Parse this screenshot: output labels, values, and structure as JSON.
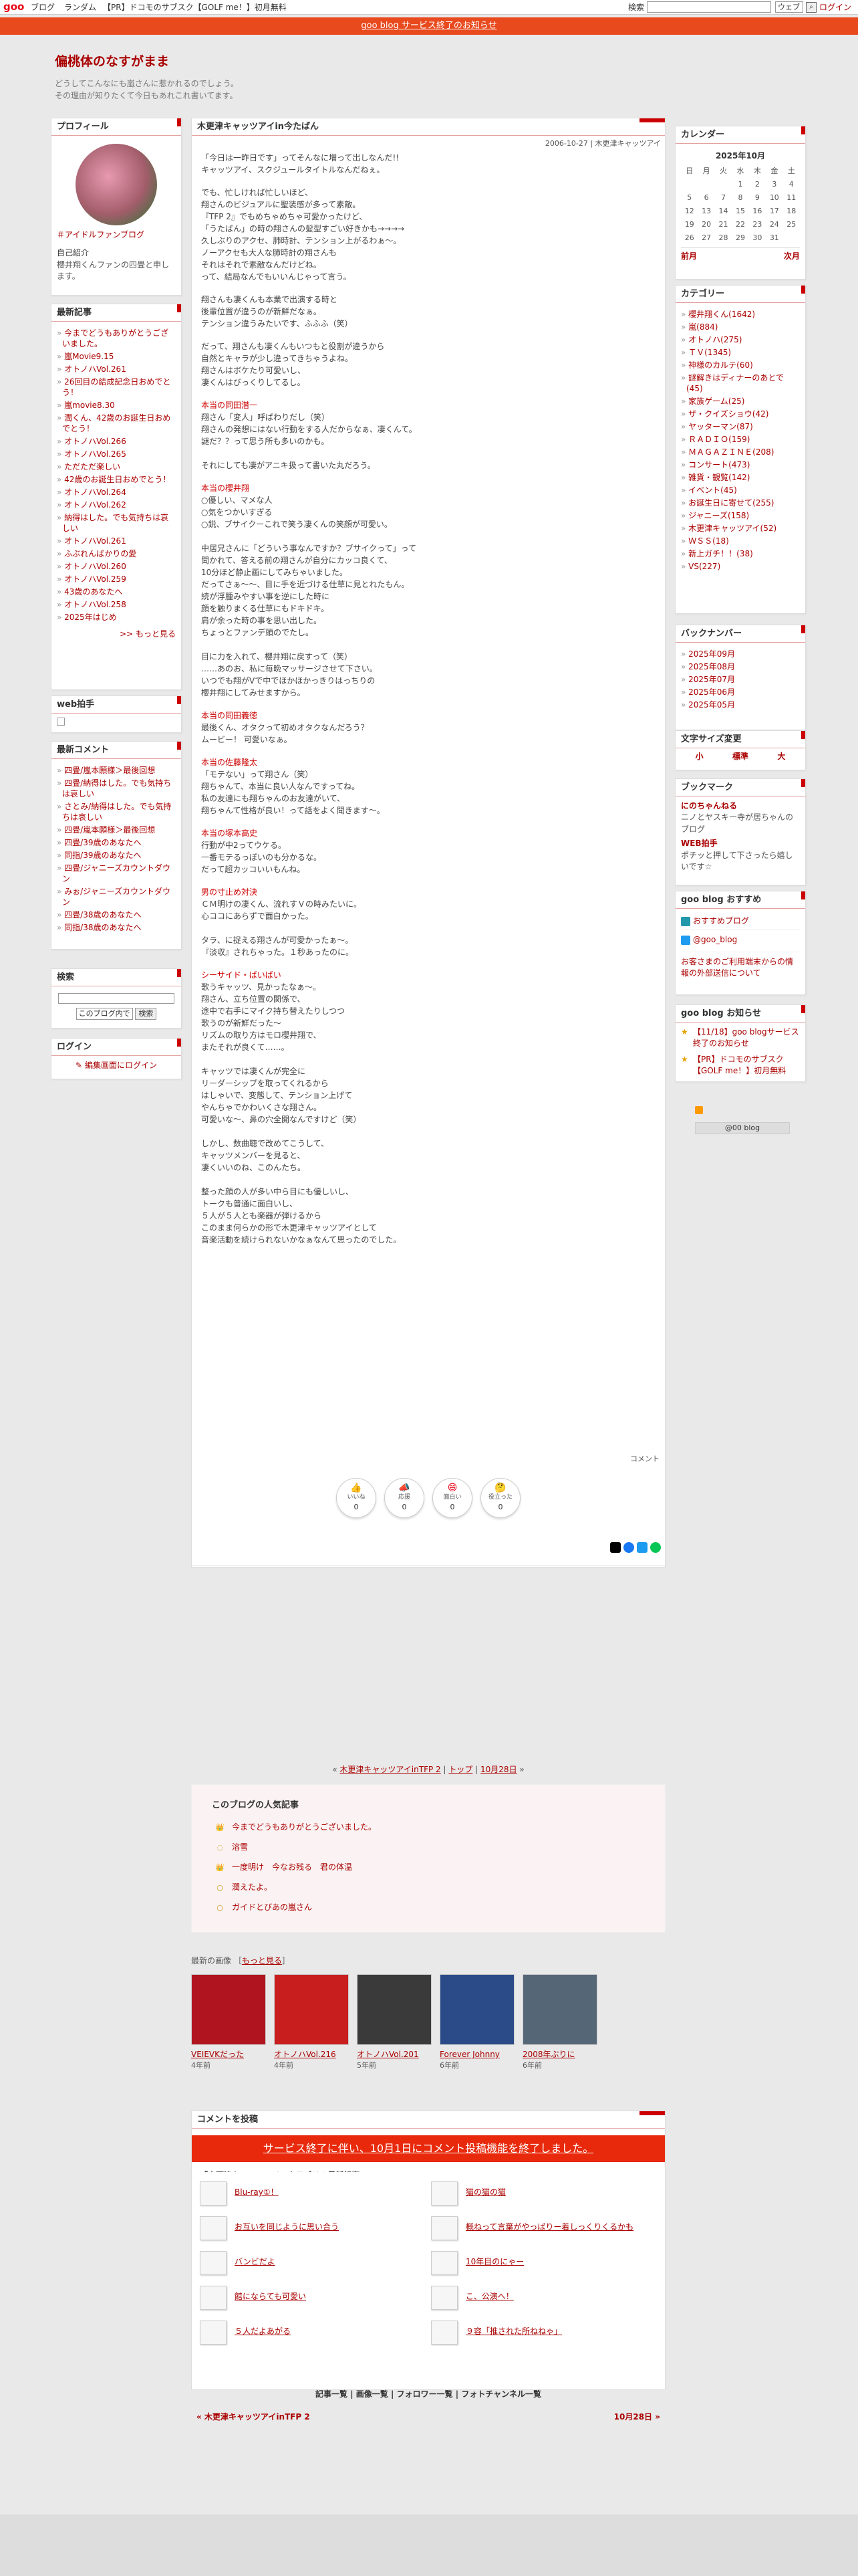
{
  "topbar": {
    "logo": "goo",
    "links": [
      "ブログ",
      "ランダム",
      "【PR】ドコモのサブスク【GOLF me！】初月無料"
    ],
    "search_label": "検索",
    "search_scope": "ウェブ",
    "login": "ログイン"
  },
  "notice": "goo blog サービス終了のお知らせ",
  "blog": {
    "title": "偏桃体のなすがまま",
    "desc1": "どうしてこんなにも嵐さんに惹かれるのでしょう。",
    "desc2": "その理由が知りたくて今日もあれこれ書いてます。"
  },
  "profile": {
    "title": "プロフィール",
    "name": "＃アイドルファンブログ",
    "intro_label": "自己紹介",
    "intro": "櫻井翔くんファンの四畳と申します。"
  },
  "recent": {
    "title": "最新記事",
    "items": [
      "今までどうもありがとうございました。",
      "嵐Movie9.15",
      "オトノハVol.261",
      "26回目の結成記念日おめでとう！",
      "嵐movie8.30",
      "潤くん、42歳のお誕生日おめでとう！",
      "オトノハVol.266",
      "オトノハVol.265",
      "ただただ楽しい",
      "42歳のお誕生日おめでとう！",
      "オトノハVol.264",
      "オトノハVol.262",
      "納得はした。でも気持ちは哀しい",
      "オトノハVol.261",
      "ふぶれんばかりの愛",
      "オトノハVol.260",
      "オトノハVol.259",
      "43歳のあなたへ",
      "オトノハVol.258",
      "2025年はじめ"
    ],
    "more": ">> もっと見る"
  },
  "webclap": {
    "title": "web拍手"
  },
  "comments": {
    "title": "最新コメント",
    "items": [
      "四畳/嵐本願様＞最後回想",
      "四畳/納得はした。でも気持ちは哀しい",
      "さとみ/納得はした。でも気持ちは哀しい",
      "四畳/嵐本願様＞最後回想",
      "四畳/39歳のあなたへ",
      "同指/39歳のあなたへ",
      "四畳/ジャニーズカウントダウン",
      "みぉ/ジャニーズカウントダウン",
      "四畳/38歳のあなたへ",
      "同指/38歳のあなたへ"
    ]
  },
  "search": {
    "title": "検索",
    "scope": "このブログ内で",
    "button": "検索"
  },
  "login": {
    "title": "ログイン",
    "link": "編集画面にログイン"
  },
  "calendar": {
    "title": "カレンダー",
    "month": "2025年10月",
    "days": [
      "日",
      "月",
      "火",
      "水",
      "木",
      "金",
      "土"
    ],
    "weeks": [
      [
        "",
        "",
        "",
        "1",
        "2",
        "3",
        "4"
      ],
      [
        "5",
        "6",
        "7",
        "8",
        "9",
        "10",
        "11"
      ],
      [
        "12",
        "13",
        "14",
        "15",
        "16",
        "17",
        "18"
      ],
      [
        "19",
        "20",
        "21",
        "22",
        "23",
        "24",
        "25"
      ],
      [
        "26",
        "27",
        "28",
        "29",
        "30",
        "31",
        ""
      ]
    ],
    "prev": "前月",
    "next": "次月"
  },
  "categories": {
    "title": "カテゴリー",
    "items": [
      "櫻井翔くん(1642)",
      "嵐(884)",
      "オトノハ(275)",
      "ＴＶ(1345)",
      "神様のカルテ(60)",
      "謎解きはディナーのあとで(45)",
      "家族ゲーム(25)",
      "ザ・クイズショウ(42)",
      "ヤッターマン(87)",
      "ＲＡＤＩＯ(159)",
      "ＭＡＧＡＺＩＮＥ(208)",
      "コンサート(473)",
      "雑貨・観覧(142)",
      "イベント(45)",
      "お誕生日に寄せて(255)",
      "ジャニーズ(158)",
      "木更津キャッツアイ(52)",
      "ＷＳＳ(18)",
      "新上ガチ！！(38)",
      "VS(227)"
    ]
  },
  "backnumber": {
    "title": "バックナンバー",
    "items": [
      "2025年09月",
      "2025年08月",
      "2025年07月",
      "2025年06月",
      "2025年05月"
    ]
  },
  "fontsize": {
    "title": "文字サイズ変更",
    "small": "小",
    "normal": "標準",
    "large": "大"
  },
  "bookmark": {
    "title": "ブックマーク",
    "items": [
      {
        "name": "にのちゃんねる",
        "desc": "ニノとヤスキー寺が居ちゃんのブログ"
      },
      {
        "name": "WEB拍手",
        "desc": "ポチッと押して下さったら嬉しいです☆"
      }
    ]
  },
  "recommend": {
    "title": "goo blog おすすめ",
    "items": [
      "おすすめブログ",
      "@goo_blog"
    ],
    "note": "お客さまのご利用端末からの情報の外部送信について"
  },
  "gooinfo": {
    "title": "goo blog お知らせ",
    "items": [
      "【11/18】goo blogサービス終了のお知らせ",
      "【PR】ドコモのサブスク【GOLF me！】初月無料"
    ],
    "badge": "@00 blog"
  },
  "post": {
    "title": "木更津キャッツアイin今たばん",
    "meta": "2006-10-27 | 木更津キャッツアイ",
    "paragraphs": [
      "「今日は一昨日です」ってそんなに増って出しなんだ!!\nキャッツアイ、スクジュールタイトルなんだねぇ。",
      "でも、忙しければ忙しいほど、\n翔さんのビジュアルに聖装感が多って素敵。\n『TFP 2』でもめちゃめちゃ可愛かったけど、\n「うたばん」の時の翔さんの髪型すごい好きかも→→→→\n久しぶりのアクセ、肺時計、テンション上がるわぁ〜。\nノーアクセも大人な肺時計の翔さんも\nそれはそれで素敵なんだけどね。\nって、結局なんでもいいんじゃって言う。",
      "翔さんも凄くんも本業で出演する時と\n後輩位置が違うのが新鮮だなぁ。\nテンション違うみたいです、ふふふ（笑）",
      "だって、翔さんも凄くんもいつもと役割が違うから\n自然とキャラが少し違ってきちゃうよね。\n翔さんはボケたり可愛いし、\n凄くんはびっくりしてるし。"
    ],
    "sections": [
      {
        "h": "本当の同田潜一",
        "t": "翔さん「変人」呼ばわりだし（笑）\n翔さんの発想にはない行動をする人だからなぁ、凄くんて。\n謎だ？？って思う所も多いのかも。\n\nそれにしても凄がアニキ扱って書いた丸だろう。"
      },
      {
        "h": "本当の櫻井翔",
        "t": "○優しい、マメな人\n○気をつかいすぎる\n○鋭、ブサイクーこれで笑う凄くんの笑顔が可愛い。\n\n中居兄さんに「どういう事なんですか？ブサイクって」って\n聞かれて、答える前の翔さんが自分にカッコ良くて、\n10分ほど静止画にしてみちゃいました。\nだってさぁ〜〜、目に手を近づける仕草に見とれたもん。\n続が浮腫みやすい事を逆にした時に\n顔を触りまくる仕草にもドキドキ。\n肩が余った時の事を思い出した。\nちょっとファンデ頭のでたし。\n\n目に力を入れて、櫻井翔に戻すって（笑）\n……あのお、私に毎晩マッサージさせて下さい。\nいつでも翔がVで中でほかほかっきりはっちりの\n櫻井翔にしてみせますから。"
      },
      {
        "h": "本当の同田義徳",
        "t": "最後くん、オタクって初めオタクなんだろう？\nムービー！ 可愛いなぁ。"
      },
      {
        "h": "本当の佐藤隆太",
        "t": "「モテない」って翔さん（笑）\n翔ちゃんて、本当に良い人なんですってね。\n私の友達にも翔ちゃんのお友達がいて、\n翔ちゃんて性格が良い！って話をよく聞きます〜。"
      },
      {
        "h": "本当の塚本高史",
        "t": "行動が中2ってウケる。\n一番モテるっぽいのも分かるな。\nだって超カッコいいもんね。"
      },
      {
        "h": "男の寸止め対決",
        "t": "ＣＭ明けの凄くん、流れすＶの時みたいに。\n心ココにあらずで面白かった。\n\nタラ、に捉える翔さんが可愛かったぁ〜。\n『淡収』されちゃった。１秒あったのに。"
      },
      {
        "h": "シーサイド・ばいばい",
        "t": "歌うキャッツ、見かったなぁ〜。\n翔さん、立ち位置の関係で、\n途中で右手にマイク持ち替えたりしつつ\n歌うのが新鮮だった〜\nリズムの取り方はモロ櫻井翔で、\nまたそれが良くて……。\n\nキャッツでは凄くんが完全に\nリーダーシップを取ってくれるから\nはしゃいで、変態して、テンション上げて\nやんちゃでかわいくさな翔さん。\n可愛いな〜、鼻の穴全開なんですけど（笑）\n\nしかし、数曲聴で改めてこうして、\nキャッツメンバーを見ると、\n凄くいいのね、このんたち。\n\n整った顔の人が多い中ら目にも優しいし、\nトークも普通に面白いし、\n５人が５人とも楽器が弾けるから\nこのまま何らかの形で木更津キャッツアイとして\n音楽活動を続けられないかなぁなんて思ったのでした。"
      }
    ],
    "comment_link": "コメント",
    "reactions": [
      {
        "icon": "👍",
        "label": "いいね",
        "count": "0"
      },
      {
        "icon": "📣",
        "label": "応援",
        "count": "0"
      },
      {
        "icon": "😄",
        "label": "面白い",
        "count": "0"
      },
      {
        "icon": "🤔",
        "label": "役立った",
        "count": "0"
      }
    ]
  },
  "pagenav": {
    "prev": "木更津キャッツアイinTFP 2",
    "top": "トップ",
    "next": "10月28日"
  },
  "popular": {
    "title": "このブログの人気記事",
    "items": [
      "今までどうもありがとうございました。",
      "溶雪",
      "一度明け　今なお残る　君の体温",
      "潤えたよ。",
      "ガイドとびあの嵐さん"
    ]
  },
  "latest_images": {
    "label": "最新の画像",
    "more": "もっと見る",
    "items": [
      {
        "cap": "VEIEVKだった",
        "age": "4年前"
      },
      {
        "cap": "オトノハVol.216",
        "age": "4年前"
      },
      {
        "cap": "オトノハVol.201",
        "age": "5年前"
      },
      {
        "cap": "Forever Johnny",
        "age": "6年前"
      },
      {
        "cap": "2008年ぶりに",
        "age": "6年前"
      }
    ]
  },
  "comment_form": {
    "title": "コメントを投稿",
    "bar": "サービス終了に伴い、10月1日にコメント投稿機能を終了しました。"
  },
  "category_latest": {
    "title": "「木更津キャッツアイ」カテゴリの最新記事",
    "items": [
      "Blu-ray①！",
      "お互いを同じように思い合う",
      "バンビだよ",
      "館にならても可愛い",
      "５人だよあがる",
      "猫の猫の猫",
      "概ねって言葉がやっぱりー着しっくりくるかも",
      "10年目のにゃー",
      "こ、公演へ！",
      "９容「推された所ねねゃ」"
    ]
  },
  "footer": {
    "links": [
      "記事一覧",
      "画像一覧",
      "フォロワー一覧",
      "フォトチャンネル一覧"
    ],
    "prev": "« 木更津キャッツアイinTFP 2",
    "next": "10月28日 »"
  }
}
